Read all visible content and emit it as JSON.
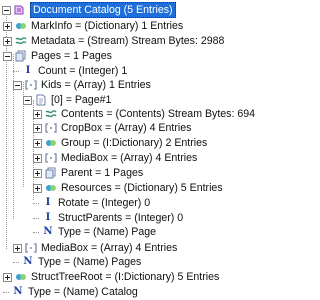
{
  "tree": {
    "root_label": "Document Catalog (5 Entries)",
    "markinfo": "MarkInfo = (Dictionary) 1 Entries",
    "metadata": "Metadata = (Stream) Stream Bytes: 2988",
    "pages": "Pages = 1 Pages",
    "count": "Count = (Integer) 1",
    "kids": "Kids = (Array) 1 Entries",
    "page0": "[0] = Page#1",
    "contents": "Contents = (Contents) Stream Bytes: 694",
    "cropbox": "CropBox = (Array) 4 Entries",
    "group": "Group = (I:Dictionary) 2 Entries",
    "mediabox_page": "MediaBox = (Array) 4 Entries",
    "parent": "Parent = 1 Pages",
    "resources": "Resources = (Dictionary) 5 Entries",
    "rotate": "Rotate = (Integer) 0",
    "structparents": "StructParents = (Integer) 0",
    "type_page": "Type = (Name) Page",
    "mediabox_pages": "MediaBox = (Array) 4 Entries",
    "type_pages": "Type = (Name) Pages",
    "structtreeroot": "StructTreeRoot = (I:Dictionary) 5 Entries",
    "type_catalog": "Type = (Name) Catalog"
  },
  "icons": {
    "integer_glyph": "I",
    "name_glyph": "N"
  },
  "colors": {
    "selection": "#1e6fd9",
    "type_glyph": "#1f3fa3",
    "dict_icon": "#3aa0d8",
    "array_icon": "#7a8aa6",
    "stream_icon": "#2f8f6a"
  }
}
